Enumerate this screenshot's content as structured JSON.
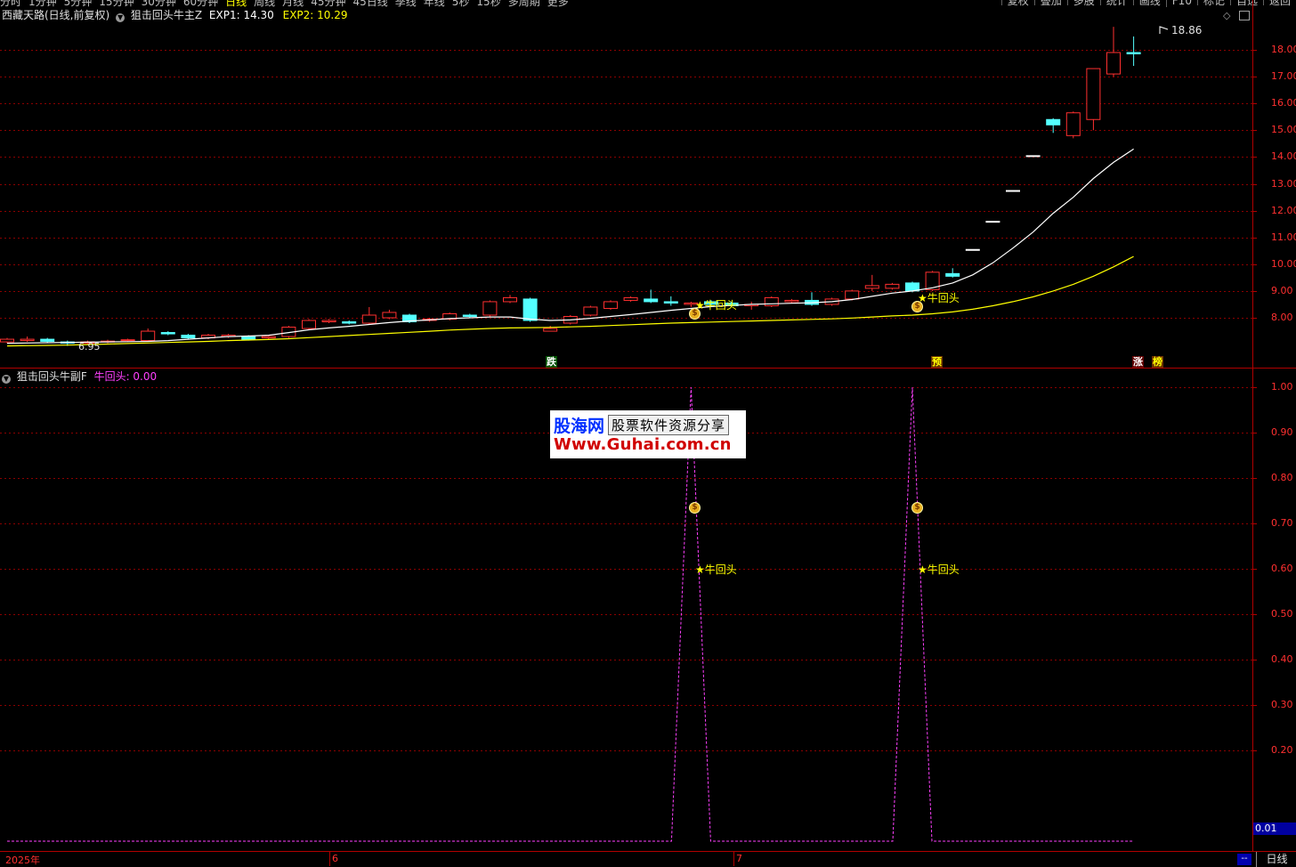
{
  "topbar": {
    "tabs": [
      "分时",
      "1分钟",
      "5分钟",
      "15分钟",
      "30分钟",
      "60分钟",
      "日线",
      "周线",
      "月线",
      "45分钟",
      "45日线",
      "季线",
      "年线",
      "5秒",
      "15秒",
      "多周期",
      "更多"
    ],
    "active_tab": "日线",
    "right_buttons": [
      "复权",
      "叠加",
      "多股",
      "统计",
      "画线",
      "F10",
      "标记",
      "自选",
      "返回"
    ]
  },
  "main_panel": {
    "stock": "西藏天路(日线,前复权)",
    "indicator": "狙击回头牛主Z",
    "exp1": "EXP1: 14.30",
    "exp2": "EXP2: 10.29",
    "high_label": "18.86",
    "low_label": "6.95",
    "y_labels": [
      "18.00",
      "17.00",
      "16.00",
      "15.00",
      "14.00",
      "13.00",
      "12.00",
      "11.00",
      "10.00",
      "9.00",
      "8.00"
    ],
    "tags": {
      "die": "跌",
      "yu": "预",
      "zhang": "涨",
      "bang": "榜"
    },
    "signal": "★牛回头",
    "bag_icon": "money-bag-icon"
  },
  "sub_panel": {
    "indicator": "狙击回头牛副F",
    "series_label": "牛回头: 0.00",
    "y_labels": [
      "1.00",
      "0.90",
      "0.80",
      "0.70",
      "0.60",
      "0.50",
      "0.40",
      "0.30",
      "0.20"
    ],
    "current_value": "0.01",
    "signal": "★牛回头"
  },
  "watermark": {
    "logo": "股海网",
    "subtitle": "股票软件资源分享",
    "url": "Www.Guhai.com.cn"
  },
  "statusbar": {
    "dates": [
      "2025年",
      "6",
      "7"
    ],
    "scroll_label": "--",
    "period_button": "日线"
  },
  "colors": {
    "up": "#ff3030",
    "down": "#54ffff",
    "exp1": "#ffffff",
    "exp2": "#ffff00",
    "sub_line": "#ff40ff",
    "grid": "#8b0000",
    "axis": "#b00000"
  },
  "chart_data": [
    {
      "type": "candlestick",
      "title": "西藏天路(日线,前复权)",
      "ylim": [
        6.6,
        19.2
      ],
      "grid": true,
      "candles": [
        [
          7.1,
          7.2,
          7.05,
          7.25
        ],
        [
          7.15,
          7.2,
          7.1,
          7.3
        ],
        [
          7.2,
          7.12,
          7.08,
          7.25
        ],
        [
          7.1,
          7.05,
          6.95,
          7.15
        ],
        [
          7.05,
          7.1,
          7.0,
          7.15
        ],
        [
          7.1,
          7.13,
          7.05,
          7.18
        ],
        [
          7.15,
          7.18,
          7.1,
          7.22
        ],
        [
          7.15,
          7.5,
          7.12,
          7.6
        ],
        [
          7.45,
          7.4,
          7.35,
          7.5
        ],
        [
          7.35,
          7.25,
          7.2,
          7.4
        ],
        [
          7.25,
          7.35,
          7.2,
          7.4
        ],
        [
          7.3,
          7.35,
          7.25,
          7.4
        ],
        [
          7.3,
          7.2,
          7.15,
          7.35
        ],
        [
          7.25,
          7.3,
          7.2,
          7.35
        ],
        [
          7.3,
          7.65,
          7.25,
          7.7
        ],
        [
          7.6,
          7.9,
          7.55,
          7.95
        ],
        [
          7.85,
          7.9,
          7.8,
          7.95
        ],
        [
          7.85,
          7.8,
          7.75,
          7.9
        ],
        [
          7.8,
          8.1,
          7.75,
          8.4
        ],
        [
          8.0,
          8.2,
          7.95,
          8.3
        ],
        [
          8.1,
          7.85,
          7.8,
          8.15
        ],
        [
          7.9,
          7.95,
          7.85,
          8.0
        ],
        [
          7.95,
          8.15,
          7.9,
          8.2
        ],
        [
          8.1,
          8.05,
          8.0,
          8.15
        ],
        [
          8.1,
          8.6,
          8.05,
          8.65
        ],
        [
          8.6,
          8.75,
          8.55,
          8.85
        ],
        [
          8.7,
          7.9,
          7.85,
          8.75
        ],
        [
          7.5,
          7.6,
          7.5,
          7.7
        ],
        [
          7.8,
          8.05,
          7.75,
          8.1
        ],
        [
          8.1,
          8.4,
          8.05,
          8.45
        ],
        [
          8.35,
          8.6,
          8.3,
          8.65
        ],
        [
          8.65,
          8.75,
          8.6,
          8.8
        ],
        [
          8.7,
          8.6,
          8.55,
          9.05
        ],
        [
          8.6,
          8.55,
          8.45,
          8.8
        ],
        [
          8.5,
          8.55,
          8.4,
          8.6
        ],
        [
          8.6,
          8.5,
          8.45,
          8.65
        ],
        [
          8.55,
          8.45,
          8.4,
          8.6
        ],
        [
          8.45,
          8.5,
          8.3,
          8.6
        ],
        [
          8.45,
          8.75,
          8.4,
          8.8
        ],
        [
          8.6,
          8.65,
          8.55,
          8.7
        ],
        [
          8.65,
          8.5,
          8.45,
          8.95
        ],
        [
          8.5,
          8.7,
          8.45,
          8.75
        ],
        [
          8.7,
          9.0,
          8.65,
          9.05
        ],
        [
          9.1,
          9.2,
          9.0,
          9.6
        ],
        [
          9.1,
          9.25,
          9.05,
          9.3
        ],
        [
          9.3,
          9.0,
          8.95,
          9.35
        ],
        [
          9.05,
          9.7,
          9.0,
          9.75
        ],
        [
          9.65,
          9.55,
          9.5,
          9.85
        ],
        [
          10.55,
          10.55,
          10.55,
          10.55
        ],
        [
          11.6,
          11.6,
          11.6,
          11.6
        ],
        [
          12.75,
          12.75,
          12.75,
          12.75
        ],
        [
          14.05,
          14.05,
          14.05,
          14.05
        ],
        [
          15.4,
          15.2,
          14.9,
          15.45
        ],
        [
          14.8,
          15.65,
          14.7,
          15.7
        ],
        [
          15.4,
          17.3,
          15.0,
          17.3
        ],
        [
          17.1,
          17.9,
          17.0,
          18.86
        ],
        [
          17.9,
          17.85,
          17.4,
          18.5
        ]
      ],
      "exp1": [
        7.05,
        7.06,
        7.07,
        7.08,
        7.09,
        7.1,
        7.11,
        7.12,
        7.15,
        7.2,
        7.25,
        7.3,
        7.32,
        7.35,
        7.45,
        7.55,
        7.62,
        7.68,
        7.75,
        7.82,
        7.88,
        7.92,
        7.97,
        8.0,
        8.03,
        8.03,
        7.95,
        7.9,
        7.92,
        7.98,
        8.05,
        8.12,
        8.2,
        8.28,
        8.35,
        8.42,
        8.46,
        8.5,
        8.52,
        8.54,
        8.56,
        8.6,
        8.68,
        8.8,
        8.92,
        9.0,
        9.12,
        9.3,
        9.6,
        10.05,
        10.6,
        11.2,
        11.9,
        12.5,
        13.2,
        13.8,
        14.3
      ],
      "exp2": [
        6.95,
        6.96,
        6.97,
        6.98,
        7.0,
        7.02,
        7.04,
        7.06,
        7.08,
        7.1,
        7.12,
        7.15,
        7.17,
        7.19,
        7.22,
        7.26,
        7.3,
        7.34,
        7.38,
        7.42,
        7.46,
        7.5,
        7.54,
        7.57,
        7.6,
        7.62,
        7.63,
        7.64,
        7.66,
        7.68,
        7.71,
        7.74,
        7.77,
        7.8,
        7.82,
        7.84,
        7.86,
        7.88,
        7.9,
        7.92,
        7.94,
        7.96,
        7.99,
        8.03,
        8.07,
        8.1,
        8.15,
        8.22,
        8.32,
        8.45,
        8.6,
        8.78,
        9.0,
        9.25,
        9.55,
        9.9,
        10.29
      ]
    },
    {
      "type": "line",
      "title": "狙击回头牛副F",
      "ylim": [
        0,
        1.0
      ],
      "series": [
        {
          "name": "牛回头",
          "values": [
            0,
            0,
            0,
            0,
            0,
            0,
            0,
            0,
            0,
            0,
            0,
            0,
            0,
            0,
            0,
            0,
            0,
            0,
            0,
            0,
            0,
            0,
            0,
            0,
            0,
            0,
            0,
            0,
            0,
            0,
            0,
            0,
            0,
            0,
            1,
            0,
            0,
            0,
            0,
            0,
            0,
            0,
            0,
            0,
            0,
            1,
            0,
            0,
            0,
            0,
            0,
            0,
            0,
            0,
            0,
            0,
            0
          ]
        }
      ]
    }
  ]
}
